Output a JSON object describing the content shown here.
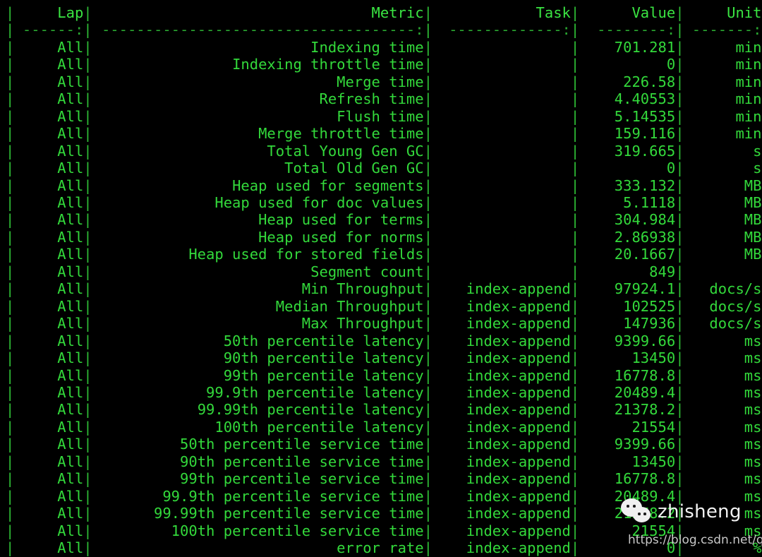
{
  "terminal": {
    "foreground_color": "#33d93b",
    "background_color": "#000000"
  },
  "table": {
    "headers": {
      "lap": "Lap",
      "metric": "Metric",
      "task": "Task",
      "value": "Value",
      "unit": "Unit"
    },
    "separators": {
      "lap": "------:",
      "metric": "------------------------------------:",
      "task": "-------------:",
      "value": "--------:",
      "unit": "-------:"
    },
    "pipe": "|",
    "rows": [
      {
        "lap": "All",
        "metric": "Indexing time",
        "task": "",
        "value": "701.281",
        "unit": "min"
      },
      {
        "lap": "All",
        "metric": "Indexing throttle time",
        "task": "",
        "value": "0",
        "unit": "min"
      },
      {
        "lap": "All",
        "metric": "Merge time",
        "task": "",
        "value": "226.58",
        "unit": "min"
      },
      {
        "lap": "All",
        "metric": "Refresh time",
        "task": "",
        "value": "4.40553",
        "unit": "min"
      },
      {
        "lap": "All",
        "metric": "Flush time",
        "task": "",
        "value": "5.14535",
        "unit": "min"
      },
      {
        "lap": "All",
        "metric": "Merge throttle time",
        "task": "",
        "value": "159.116",
        "unit": "min"
      },
      {
        "lap": "All",
        "metric": "Total Young Gen GC",
        "task": "",
        "value": "319.665",
        "unit": "s"
      },
      {
        "lap": "All",
        "metric": "Total Old Gen GC",
        "task": "",
        "value": "0",
        "unit": "s"
      },
      {
        "lap": "All",
        "metric": "Heap used for segments",
        "task": "",
        "value": "333.132",
        "unit": "MB"
      },
      {
        "lap": "All",
        "metric": "Heap used for doc values",
        "task": "",
        "value": "5.1118",
        "unit": "MB"
      },
      {
        "lap": "All",
        "metric": "Heap used for terms",
        "task": "",
        "value": "304.984",
        "unit": "MB"
      },
      {
        "lap": "All",
        "metric": "Heap used for norms",
        "task": "",
        "value": "2.86938",
        "unit": "MB"
      },
      {
        "lap": "All",
        "metric": "Heap used for stored fields",
        "task": "",
        "value": "20.1667",
        "unit": "MB"
      },
      {
        "lap": "All",
        "metric": "Segment count",
        "task": "",
        "value": "849",
        "unit": ""
      },
      {
        "lap": "All",
        "metric": "Min Throughput",
        "task": "index-append",
        "value": "97924.1",
        "unit": "docs/s"
      },
      {
        "lap": "All",
        "metric": "Median Throughput",
        "task": "index-append",
        "value": "102525",
        "unit": "docs/s"
      },
      {
        "lap": "All",
        "metric": "Max Throughput",
        "task": "index-append",
        "value": "147936",
        "unit": "docs/s"
      },
      {
        "lap": "All",
        "metric": "50th percentile latency",
        "task": "index-append",
        "value": "9399.66",
        "unit": "ms"
      },
      {
        "lap": "All",
        "metric": "90th percentile latency",
        "task": "index-append",
        "value": "13450",
        "unit": "ms"
      },
      {
        "lap": "All",
        "metric": "99th percentile latency",
        "task": "index-append",
        "value": "16778.8",
        "unit": "ms"
      },
      {
        "lap": "All",
        "metric": "99.9th percentile latency",
        "task": "index-append",
        "value": "20489.4",
        "unit": "ms"
      },
      {
        "lap": "All",
        "metric": "99.99th percentile latency",
        "task": "index-append",
        "value": "21378.2",
        "unit": "ms"
      },
      {
        "lap": "All",
        "metric": "100th percentile latency",
        "task": "index-append",
        "value": "21554",
        "unit": "ms"
      },
      {
        "lap": "All",
        "metric": "50th percentile service time",
        "task": "index-append",
        "value": "9399.66",
        "unit": "ms"
      },
      {
        "lap": "All",
        "metric": "90th percentile service time",
        "task": "index-append",
        "value": "13450",
        "unit": "ms"
      },
      {
        "lap": "All",
        "metric": "99th percentile service time",
        "task": "index-append",
        "value": "16778.8",
        "unit": "ms"
      },
      {
        "lap": "All",
        "metric": "99.9th percentile service time",
        "task": "index-append",
        "value": "20489.4",
        "unit": "ms"
      },
      {
        "lap": "All",
        "metric": "99.99th percentile service time",
        "task": "index-append",
        "value": "21378.2",
        "unit": "ms"
      },
      {
        "lap": "All",
        "metric": "100th percentile service time",
        "task": "index-append",
        "value": "21554",
        "unit": "ms"
      },
      {
        "lap": "All",
        "metric": "error rate",
        "task": "index-append",
        "value": "0",
        "unit": "%"
      }
    ]
  },
  "watermark": {
    "name": "zhisheng",
    "url": "https://blog.csdn.net/qzly",
    "logo_icon": "wechat-icon"
  }
}
